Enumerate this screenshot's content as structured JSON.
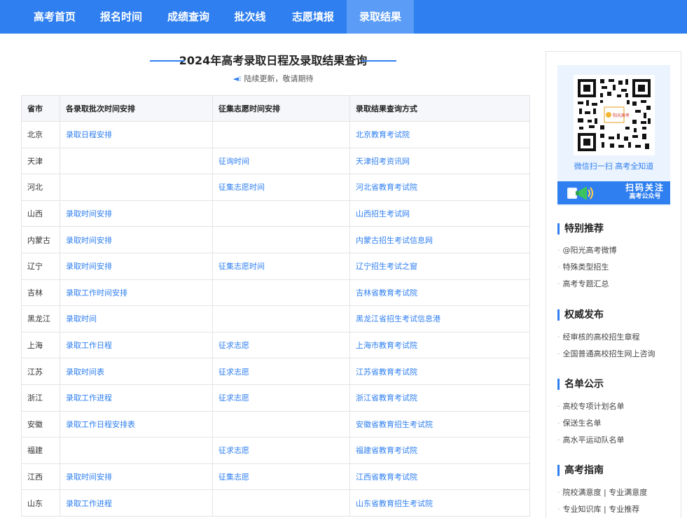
{
  "nav": {
    "items": [
      {
        "label": "高考首页"
      },
      {
        "label": "报名时间"
      },
      {
        "label": "成绩查询"
      },
      {
        "label": "批次线"
      },
      {
        "label": "志愿填报"
      },
      {
        "label": "录取结果"
      }
    ],
    "active": "录取结果"
  },
  "main": {
    "title": "2024年高考录取日程及录取结果查询",
    "subtitle": "陆续更新，敬请期待",
    "table": {
      "headers": [
        "省市",
        "各录取批次时间安排",
        "征集志愿时间安排",
        "录取结果查询方式"
      ],
      "rows": [
        {
          "province": "北京",
          "schedule": "录取日程安排",
          "solicit": "",
          "query": "北京教育考试院"
        },
        {
          "province": "天津",
          "schedule": "",
          "solicit": "征询时间",
          "query": "天津招考资讯网"
        },
        {
          "province": "河北",
          "schedule": "",
          "solicit": "征集志愿时间",
          "query": "河北省教育考试院"
        },
        {
          "province": "山西",
          "schedule": "录取时间安排",
          "solicit": "",
          "query": "山西招生考试网"
        },
        {
          "province": "内蒙古",
          "schedule": "录取时间安排",
          "solicit": "",
          "query": "内蒙古招生考试信息网"
        },
        {
          "province": "辽宁",
          "schedule": "录取时间安排",
          "solicit": "征集志愿时间",
          "query": "辽宁招生考试之窗"
        },
        {
          "province": "吉林",
          "schedule": "录取工作时间安排",
          "solicit": "",
          "query": "吉林省教育考试院"
        },
        {
          "province": "黑龙江",
          "schedule": "录取时间",
          "solicit": "",
          "query": "黑龙江省招生考试信息港"
        },
        {
          "province": "上海",
          "schedule": "录取工作日程",
          "solicit": "征求志愿",
          "query": "上海市教育考试院"
        },
        {
          "province": "江苏",
          "schedule": "录取时间表",
          "solicit": "征求志愿",
          "query": "江苏省教育考试院"
        },
        {
          "province": "浙江",
          "schedule": "录取工作进程",
          "solicit": "征求志愿",
          "query": "浙江省教育考试院"
        },
        {
          "province": "安徽",
          "schedule": "录取工作日程安排表",
          "solicit": "",
          "query": "安徽省教育招生考试院"
        },
        {
          "province": "福建",
          "schedule": "",
          "solicit": "征求志愿",
          "query": "福建省教育考试院"
        },
        {
          "province": "江西",
          "schedule": "录取时间安排",
          "solicit": "征集志愿",
          "query": "江西省教育考试院"
        },
        {
          "province": "山东",
          "schedule": "录取工作进程",
          "solicit": "",
          "query": "山东省教育招生考试院"
        }
      ]
    }
  },
  "sidebar": {
    "qr": {
      "caption": "微信扫一扫 高考全知道",
      "banner_line1": "扫码关注",
      "banner_line2": "高考公众号",
      "center_mark": "阳光高考"
    },
    "sections": [
      {
        "title": "特别推荐",
        "items": [
          "@阳光高考微博",
          "特殊类型招生",
          "高考专题汇总"
        ]
      },
      {
        "title": "权威发布",
        "items": [
          "经审核的高校招生章程",
          "全国普通高校招生网上咨询"
        ]
      },
      {
        "title": "名单公示",
        "items": [
          "高校专项计划名单",
          "保送生名单",
          "高水平运动队名单"
        ]
      },
      {
        "title": "高考指南",
        "items": [
          "院校满意度 | 专业满意度",
          "专业知识库 | 专业推荐"
        ]
      }
    ]
  },
  "colors": {
    "accent": "#2f7ff0",
    "nav_active": "#5b9cf6",
    "header_bg": "#f5f7fa"
  },
  "icons": {
    "subtitle": "speaker-icon",
    "banner": "megaphone-icon",
    "qr": "qr-code-icon"
  }
}
